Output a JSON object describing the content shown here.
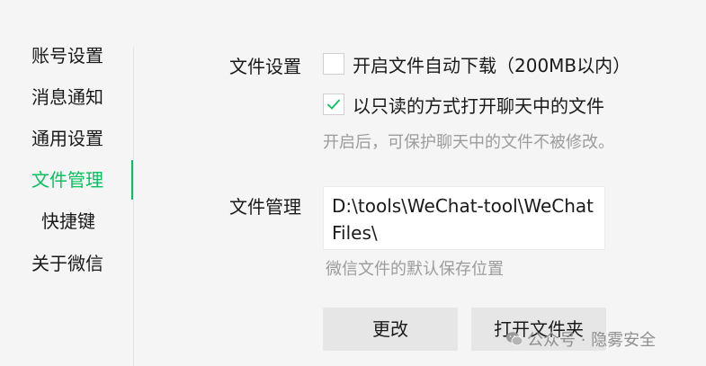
{
  "colors": {
    "accent": "#07c160",
    "hint": "#9c9c9c",
    "background": "#f5f5f5"
  },
  "sidebar": {
    "items": [
      {
        "label": "账号设置"
      },
      {
        "label": "消息通知"
      },
      {
        "label": "通用设置"
      },
      {
        "label": "文件管理",
        "active": true
      },
      {
        "label": "快捷键"
      },
      {
        "label": "关于微信"
      }
    ]
  },
  "file_settings": {
    "label": "文件设置",
    "auto_download": {
      "label": "开启文件自动下载（200MB以内）",
      "checked": false
    },
    "read_only": {
      "label": "以只读的方式打开聊天中的文件",
      "checked": true
    },
    "hint": "开启后，可保护聊天中的文件不被修改。"
  },
  "file_management": {
    "label": "文件管理",
    "path": "D:\\tools\\WeChat-tool\\WeChat Files\\",
    "hint": "微信文件的默认保存位置",
    "change_button": "更改",
    "open_folder_button": "打开文件夹"
  },
  "watermark": {
    "icon": "wechat-logo-icon",
    "text": "公众号 · 隐雾安全"
  }
}
